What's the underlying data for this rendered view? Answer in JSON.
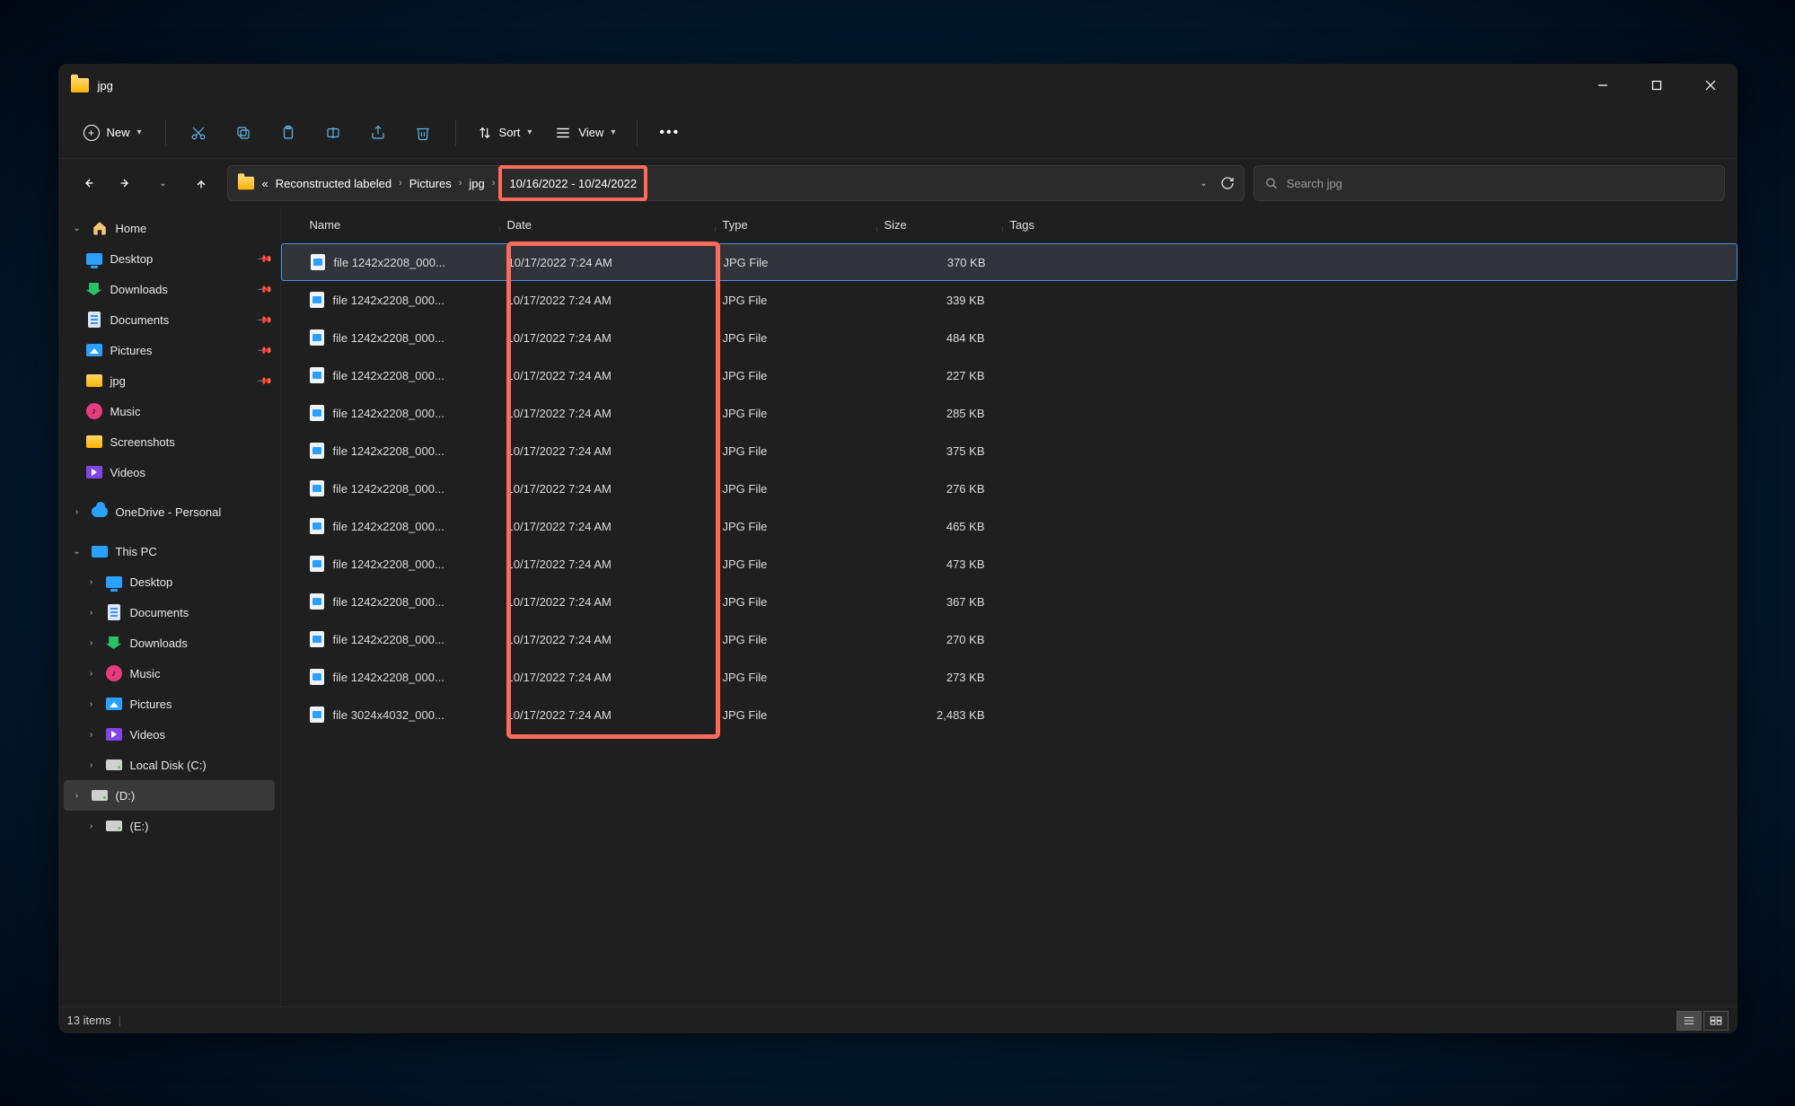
{
  "window": {
    "title": "jpg"
  },
  "toolbar": {
    "new_label": "New",
    "sort_label": "Sort",
    "view_label": "View"
  },
  "breadcrumbs": {
    "ellipsis": "«",
    "items": [
      "Reconstructed labeled",
      "Pictures",
      "jpg"
    ],
    "filter": "10/16/2022 - 10/24/2022"
  },
  "search": {
    "placeholder": "Search jpg"
  },
  "sidebar": {
    "home": "Home",
    "quick": [
      {
        "label": "Desktop",
        "icon": "desktop",
        "pinned": true
      },
      {
        "label": "Downloads",
        "icon": "down",
        "pinned": true
      },
      {
        "label": "Documents",
        "icon": "docs",
        "pinned": true
      },
      {
        "label": "Pictures",
        "icon": "pics",
        "pinned": true
      },
      {
        "label": "jpg",
        "icon": "folder",
        "pinned": true
      },
      {
        "label": "Music",
        "icon": "music",
        "pinned": false
      },
      {
        "label": "Screenshots",
        "icon": "folder",
        "pinned": false
      },
      {
        "label": "Videos",
        "icon": "videos",
        "pinned": false
      }
    ],
    "onedrive": "OneDrive - Personal",
    "thispc_label": "This PC",
    "thispc": [
      {
        "label": "Desktop",
        "icon": "desktop"
      },
      {
        "label": "Documents",
        "icon": "docs"
      },
      {
        "label": "Downloads",
        "icon": "down"
      },
      {
        "label": "Music",
        "icon": "music"
      },
      {
        "label": "Pictures",
        "icon": "pics"
      },
      {
        "label": "Videos",
        "icon": "videos"
      },
      {
        "label": "Local Disk (C:)",
        "icon": "disk"
      },
      {
        "label": "(D:)",
        "icon": "disk",
        "selected": true
      },
      {
        "label": "(E:)",
        "icon": "disk"
      }
    ]
  },
  "columns": {
    "name": "Name",
    "date": "Date",
    "type": "Type",
    "size": "Size",
    "tags": "Tags"
  },
  "files": [
    {
      "name": "file 1242x2208_000...",
      "date": "10/17/2022 7:24 AM",
      "type": "JPG File",
      "size": "370 KB",
      "selected": true
    },
    {
      "name": "file 1242x2208_000...",
      "date": "10/17/2022 7:24 AM",
      "type": "JPG File",
      "size": "339 KB"
    },
    {
      "name": "file 1242x2208_000...",
      "date": "10/17/2022 7:24 AM",
      "type": "JPG File",
      "size": "484 KB"
    },
    {
      "name": "file 1242x2208_000...",
      "date": "10/17/2022 7:24 AM",
      "type": "JPG File",
      "size": "227 KB"
    },
    {
      "name": "file 1242x2208_000...",
      "date": "10/17/2022 7:24 AM",
      "type": "JPG File",
      "size": "285 KB"
    },
    {
      "name": "file 1242x2208_000...",
      "date": "10/17/2022 7:24 AM",
      "type": "JPG File",
      "size": "375 KB"
    },
    {
      "name": "file 1242x2208_000...",
      "date": "10/17/2022 7:24 AM",
      "type": "JPG File",
      "size": "276 KB"
    },
    {
      "name": "file 1242x2208_000...",
      "date": "10/17/2022 7:24 AM",
      "type": "JPG File",
      "size": "465 KB"
    },
    {
      "name": "file 1242x2208_000...",
      "date": "10/17/2022 7:24 AM",
      "type": "JPG File",
      "size": "473 KB"
    },
    {
      "name": "file 1242x2208_000...",
      "date": "10/17/2022 7:24 AM",
      "type": "JPG File",
      "size": "367 KB"
    },
    {
      "name": "file 1242x2208_000...",
      "date": "10/17/2022 7:24 AM",
      "type": "JPG File",
      "size": "270 KB"
    },
    {
      "name": "file 1242x2208_000...",
      "date": "10/17/2022 7:24 AM",
      "type": "JPG File",
      "size": "273 KB"
    },
    {
      "name": "file 3024x4032_000...",
      "date": "10/17/2022 7:24 AM",
      "type": "JPG File",
      "size": "2,483 KB"
    }
  ],
  "status": {
    "count_label": "13 items"
  }
}
